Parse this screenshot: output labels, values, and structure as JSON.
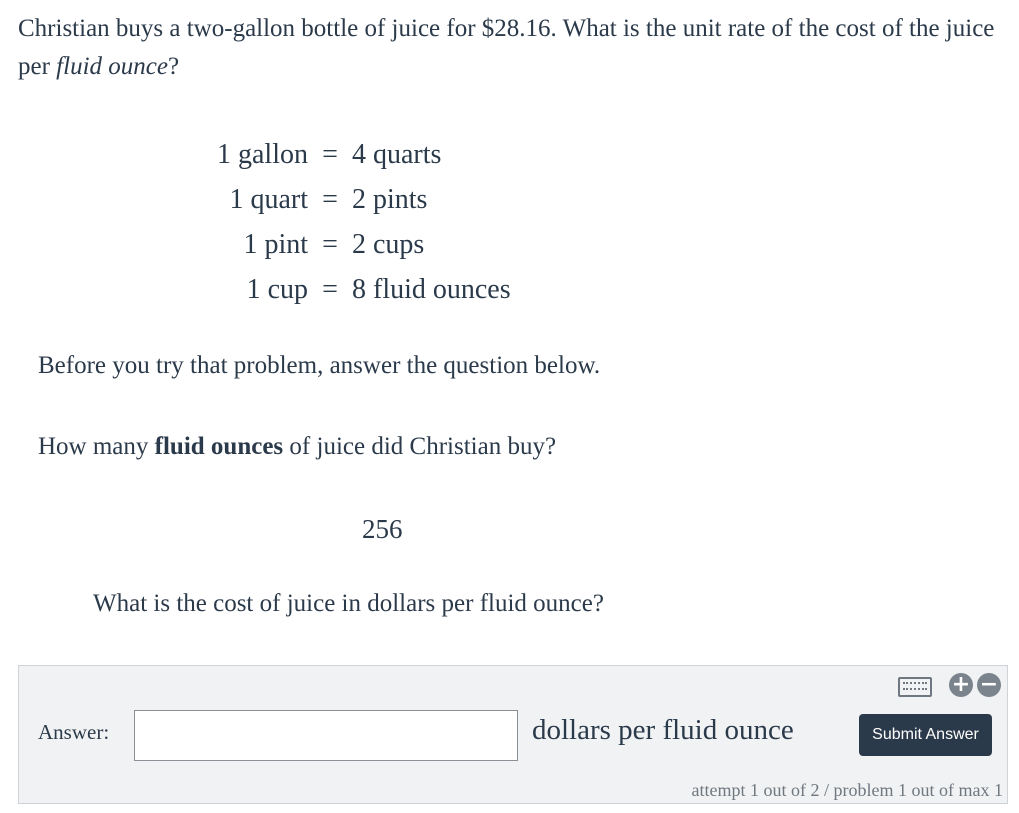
{
  "problem": {
    "text_before": "Christian buys a two-gallon bottle of juice for $28.16. What is the unit rate of the cost of the juice per ",
    "text_italic": "fluid ounce",
    "text_after": "?"
  },
  "conversions": [
    {
      "left": "1 gallon",
      "eq": "=",
      "right": "4 quarts"
    },
    {
      "left": "1 quart",
      "eq": "=",
      "right": "2 pints"
    },
    {
      "left": "1 pint",
      "eq": "=",
      "right": "2 cups"
    },
    {
      "left": "1 cup",
      "eq": "=",
      "right": "8 fluid ounces"
    }
  ],
  "intro": "Before you try that problem, answer the question below.",
  "question1": {
    "before": "How many ",
    "bold": "fluid ounces",
    "after": " of juice did Christian buy?"
  },
  "answer1": "256",
  "question2": "What is the cost of juice in dollars per fluid ounce?",
  "answer_panel": {
    "label": "Answer:",
    "input_value": "",
    "unit": "dollars per fluid ounce",
    "submit_label": "Submit Answer",
    "zoom_in_glyph": "+",
    "zoom_out_glyph": "−",
    "attempt_info": "attempt 1 out of 2 / problem 1 out of max 1"
  },
  "icons": {
    "keyboard": "keyboard-icon",
    "zoom_in": "zoom-in-icon",
    "zoom_out": "zoom-out-icon"
  }
}
